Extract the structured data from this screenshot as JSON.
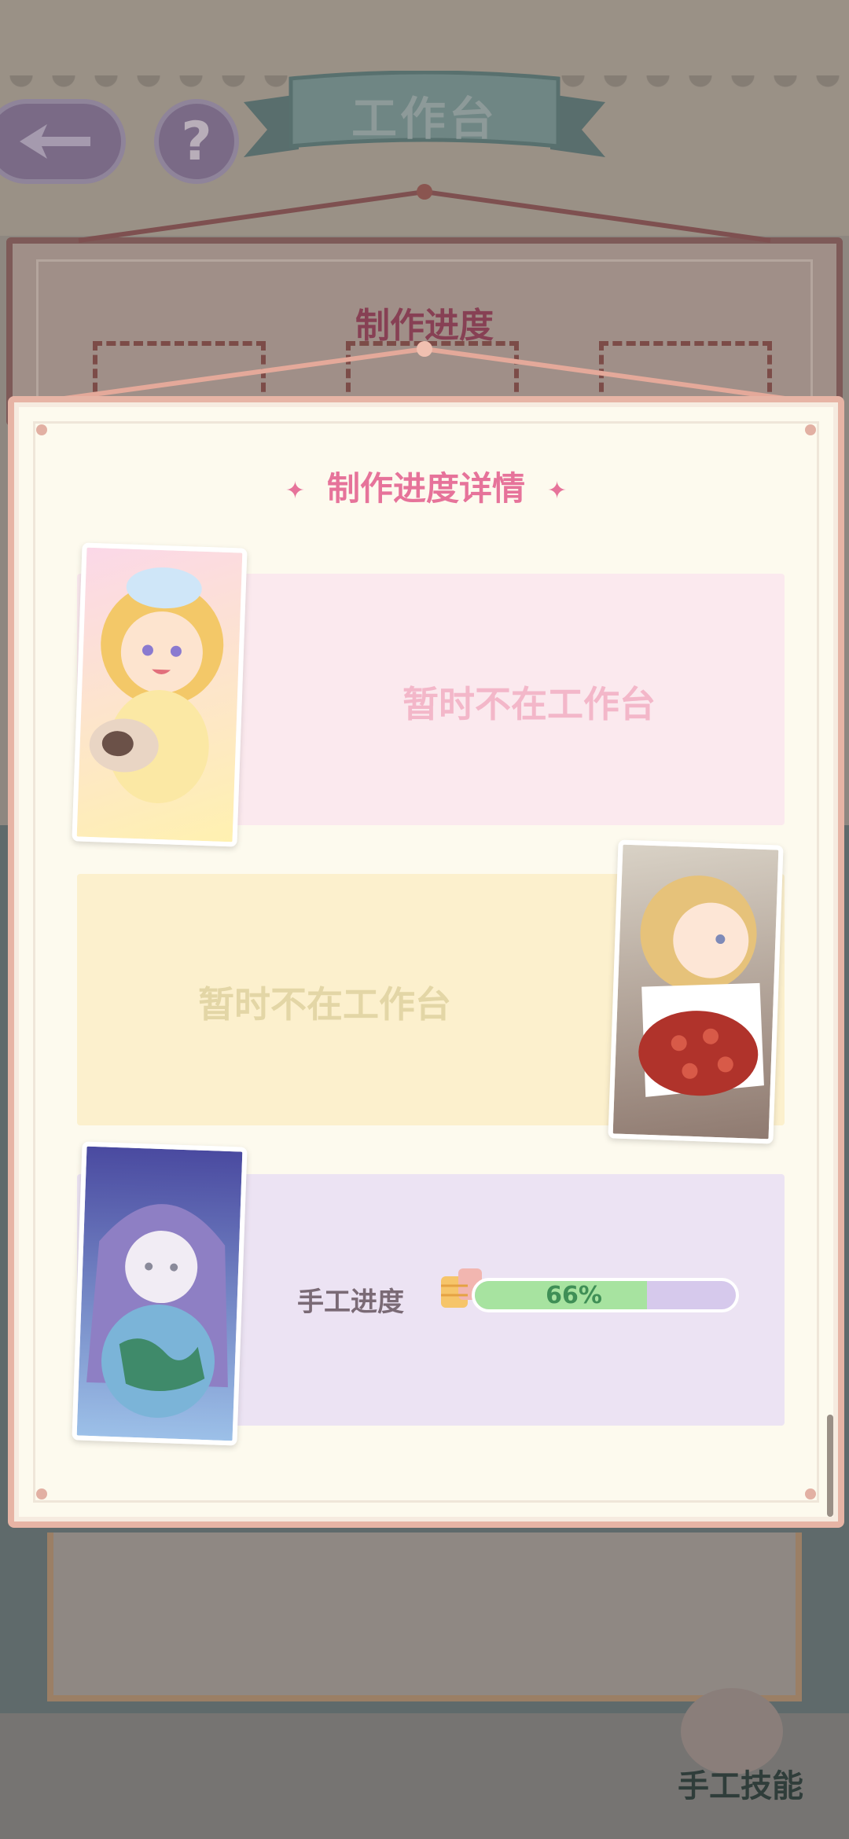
{
  "header": {
    "title": "工作台",
    "help_label": "?"
  },
  "background_board": {
    "title": "制作进度",
    "slots": 3
  },
  "modal": {
    "title": "制作进度详情",
    "title_deco": "✦",
    "cards": [
      {
        "status": "暂时不在工作台",
        "color": "#fbe9ee",
        "text_color": "#f3b7c9",
        "character": "blonde-girl-with-pug"
      },
      {
        "status": "暂时不在工作台",
        "color": "#fcf0cd",
        "text_color": "#e3d6a6",
        "character": "girl-with-rose-bouquet"
      },
      {
        "status": null,
        "color": "#ece3f3",
        "character": "hooded-girl-with-globe"
      }
    ],
    "progress": {
      "label": "手工进度",
      "percent": 66,
      "percent_text": "66%"
    }
  },
  "footer": {
    "skill_label": "手工技能"
  }
}
